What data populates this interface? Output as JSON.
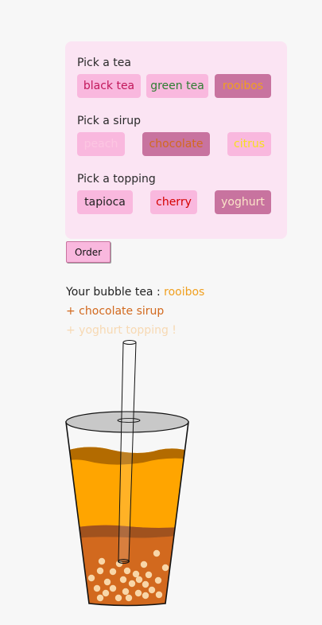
{
  "panel": {
    "tea": {
      "label": "Pick a tea",
      "options": [
        {
          "text": "black tea",
          "color": "#c2185b",
          "selected": false
        },
        {
          "text": "green tea",
          "color": "#2e7d32",
          "selected": false
        },
        {
          "text": "rooibos",
          "color": "#f0a020",
          "selected": true
        }
      ]
    },
    "sirup": {
      "label": "Pick a sirup",
      "options": [
        {
          "text": "peach",
          "color": "#fcc6e2",
          "selected": false
        },
        {
          "text": "chocolate",
          "color": "#d2691e",
          "selected": true
        },
        {
          "text": "citrus",
          "color": "#f6df20",
          "selected": false
        }
      ]
    },
    "topping": {
      "label": "Pick a topping",
      "options": [
        {
          "text": "tapioca",
          "color": "#222222",
          "selected": false
        },
        {
          "text": "cherry",
          "color": "#d50000",
          "selected": false
        },
        {
          "text": "yoghurt",
          "color": "#fbe4c8",
          "selected": true
        }
      ]
    }
  },
  "order_button": "Order",
  "summary": {
    "prefix": "Your bubble tea : ",
    "tea": "rooibos",
    "tea_color": "#f0a020",
    "sirup_line": "+ chocolate sirup",
    "sirup_color": "#d2691e",
    "topping_line": "+ yoghurt topping !",
    "topping_color": "#f7d9b3"
  },
  "drink_colors": {
    "tea": "#ffa500",
    "tea_top": "#b36b00",
    "sirup": "#d2691e",
    "sirup_top": "#a0521e",
    "pearls": "#f8d6a8",
    "lid": "#c8c8c8"
  }
}
